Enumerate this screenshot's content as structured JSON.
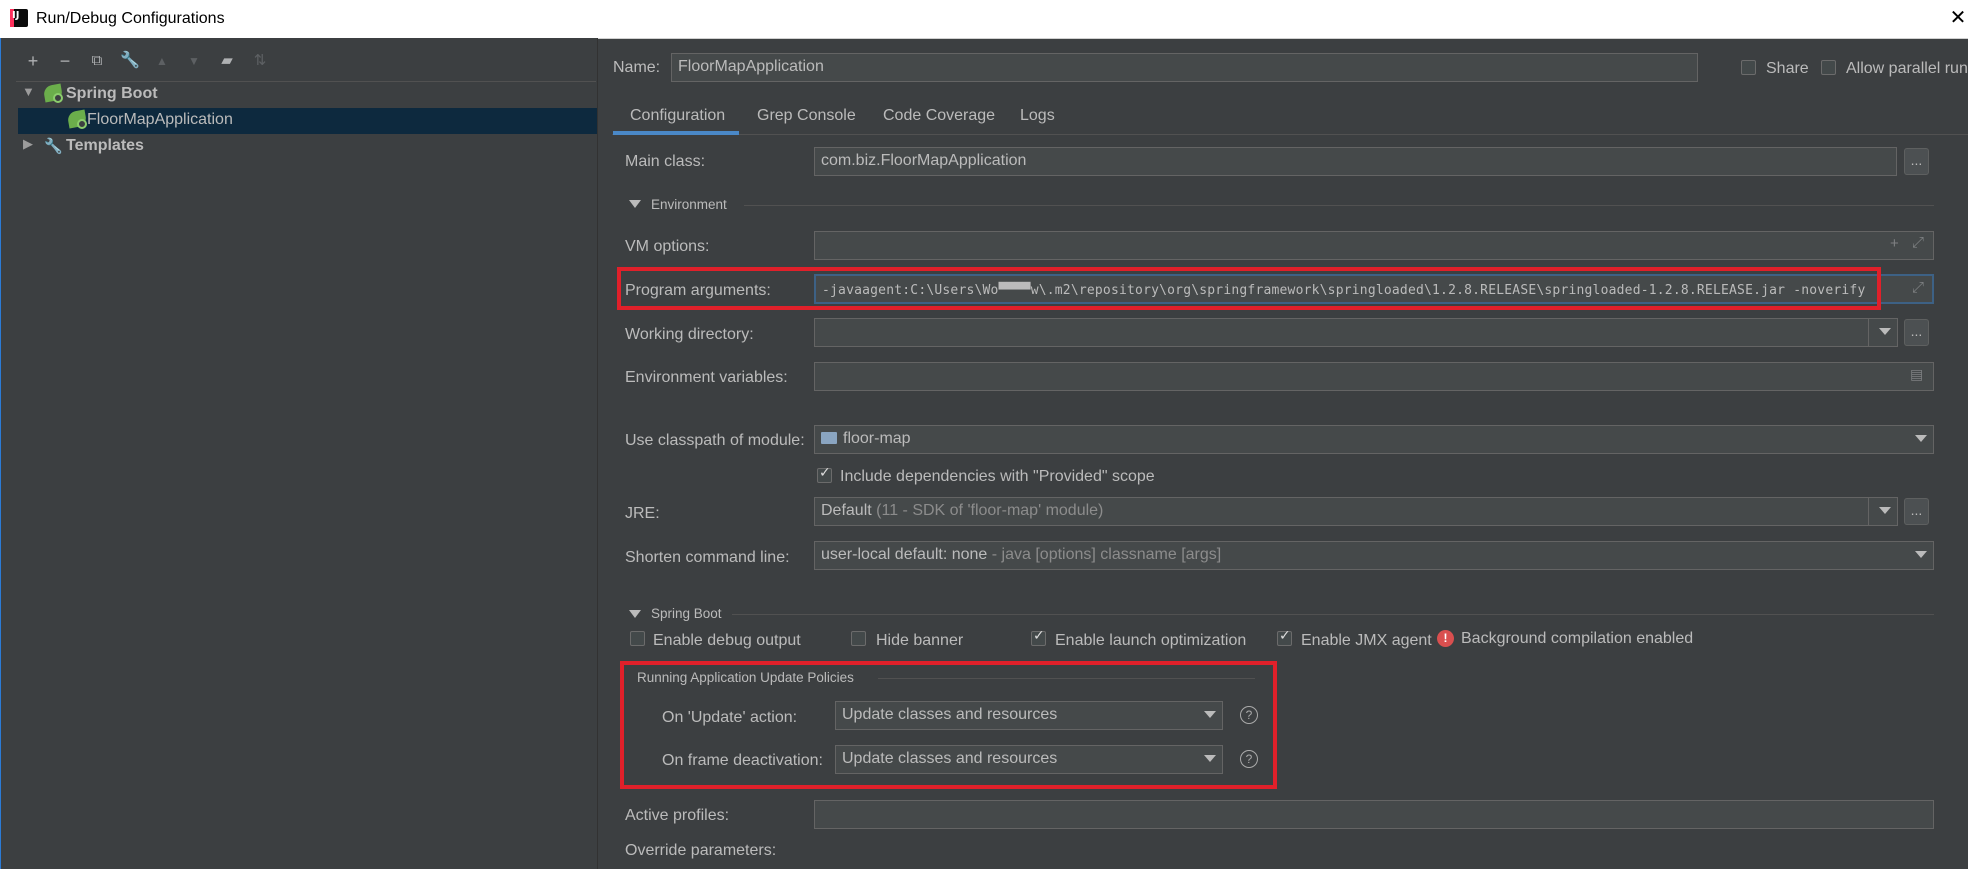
{
  "window": {
    "title": "Run/Debug Configurations"
  },
  "tree": {
    "spring_boot": "Spring Boot",
    "app": "FloorMapApplication",
    "templates": "Templates"
  },
  "header": {
    "name_label": "Name:",
    "name_value": "FloorMapApplication",
    "share_label": "Share",
    "parallel_label": "Allow parallel run"
  },
  "tabs": [
    "Configuration",
    "Grep Console",
    "Code Coverage",
    "Logs"
  ],
  "config": {
    "main_class_label": "Main class:",
    "main_class_value": "com.biz.FloorMapApplication",
    "environment_title": "Environment",
    "vm_options_label": "VM options:",
    "program_args_label": "Program arguments:",
    "program_args_value": "-javaagent:C:\\Users\\Wo▀▀▀▀w\\.m2\\repository\\org\\springframework\\springloaded\\1.2.8.RELEASE\\springloaded-1.2.8.RELEASE.jar -noverify",
    "working_dir_label": "Working directory:",
    "env_vars_label": "Environment variables:",
    "classpath_label": "Use classpath of module:",
    "classpath_value": "floor-map",
    "include_deps_label": "Include dependencies with \"Provided\" scope",
    "jre_label": "JRE:",
    "jre_value_main": "Default",
    "jre_value_hint": "(11 - SDK of 'floor-map' module)",
    "shorten_label": "Shorten command line:",
    "shorten_value_main": "user-local default: none",
    "shorten_value_hint": "- java [options] classname [args]",
    "spring_boot_title": "Spring Boot",
    "debug_output_label": "Enable debug output",
    "hide_banner_label": "Hide banner",
    "launch_opt_label": "Enable launch optimization",
    "jmx_label": "Enable JMX agent",
    "bg_compile_label": "Background compilation enabled",
    "policies_title": "Running Application Update Policies",
    "on_update_label": "On 'Update' action:",
    "on_update_value": "Update classes and resources",
    "on_frame_label": "On frame deactivation:",
    "on_frame_value": "Update classes and resources",
    "active_profiles_label": "Active profiles:",
    "override_params_label": "Override parameters:"
  }
}
